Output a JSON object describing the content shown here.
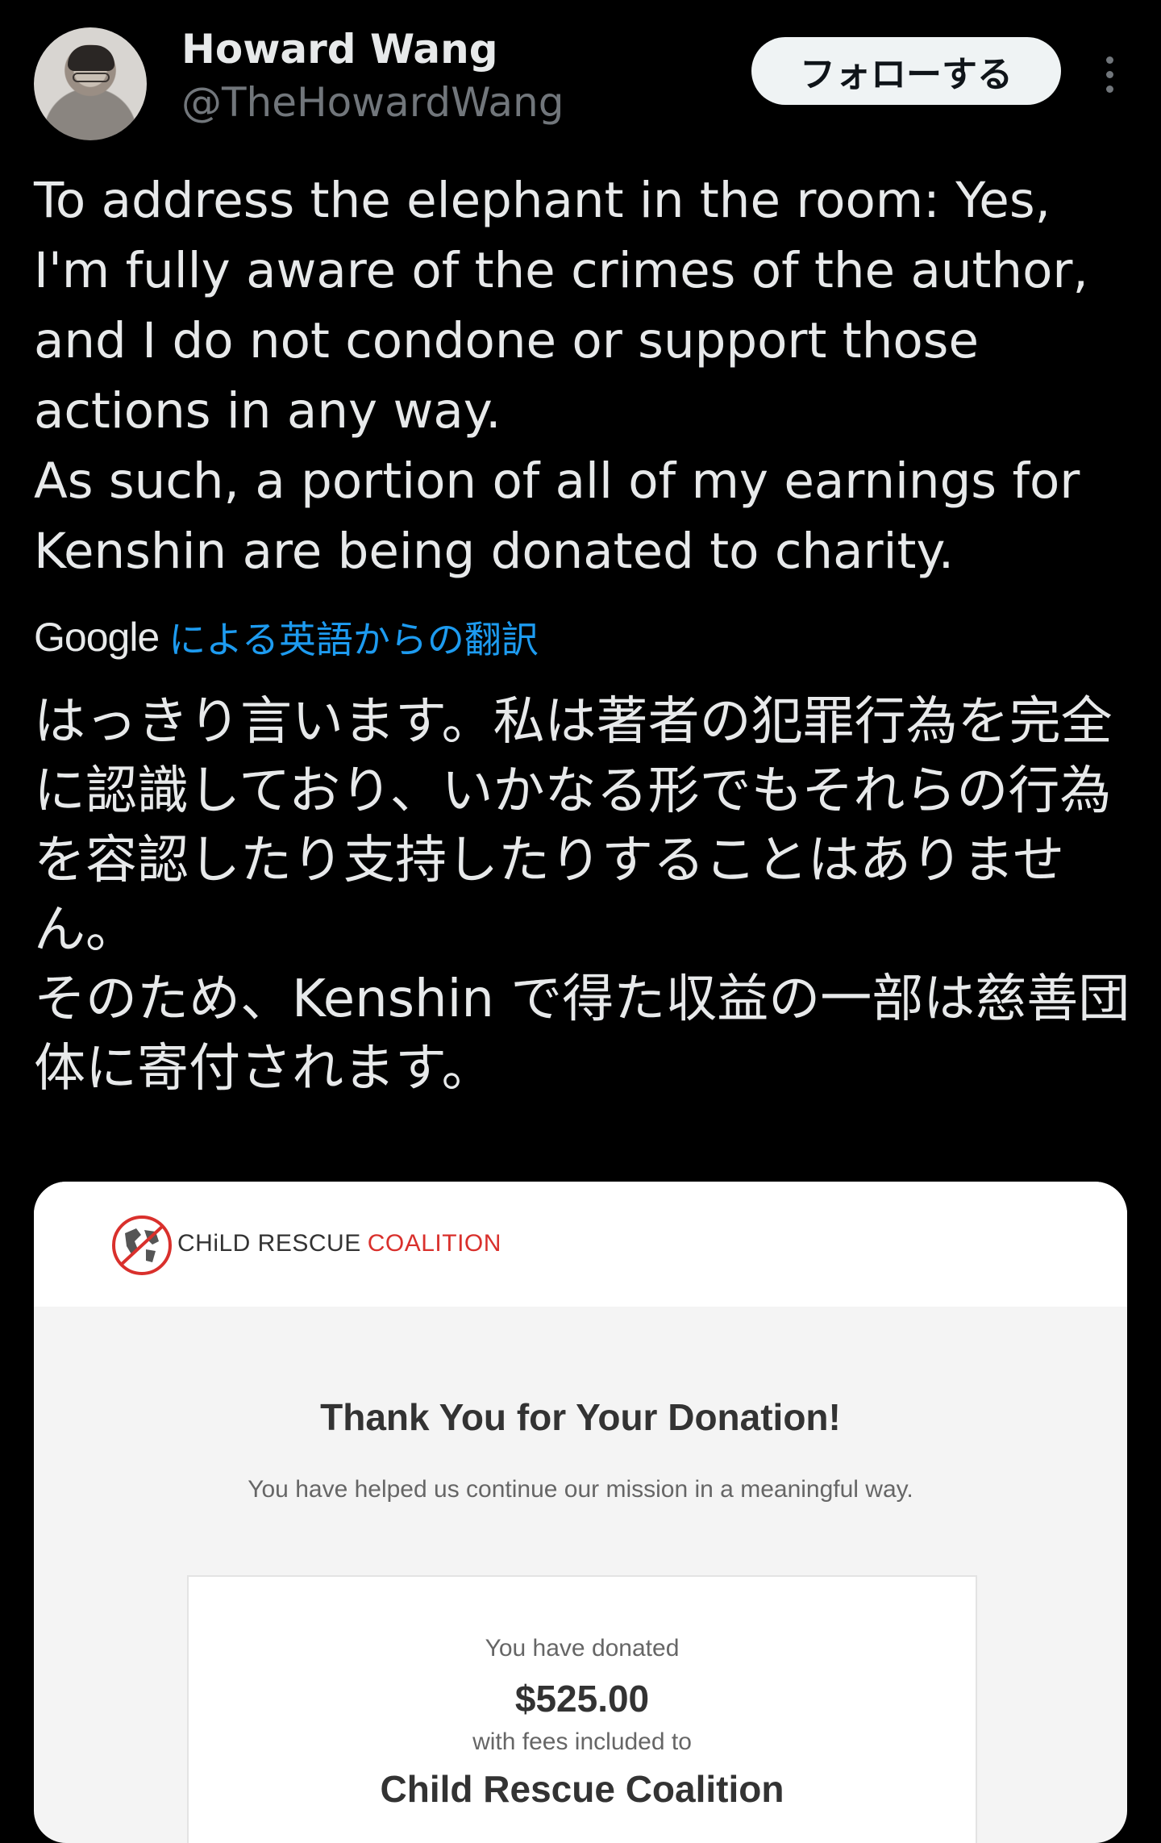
{
  "tweet": {
    "author": {
      "display_name": "Howard Wang",
      "handle": "@TheHowardWang"
    },
    "follow_label": "フォローする",
    "more_icon": "more-vertical-icon",
    "text": "To address the elephant in the room: Yes, I'm fully aware of the crimes of the author, and I do not condone or support those actions in any way.\nAs such, a portion of all of my earnings for Kenshin are being donated to charity.",
    "translation": {
      "provider": "Google",
      "link_label": "による英語からの翻訳",
      "text": "はっきり言います。私は著者の犯罪行為を完全に認識しており、いかなる形でもそれらの行為を容認したり支持したりすることはありません。\nそのため、Kenshin で得た収益の一部は慈善団体に寄付されます。"
    }
  },
  "media": {
    "org_logo_icon": "globe-circle-logo-icon",
    "org_name_part1": "CHiLD RESCUE",
    "org_name_part2": "COALITION",
    "title": "Thank You for Your Donation!",
    "subtitle": "You have helped us continue our mission in a meaningful way.",
    "receipt": {
      "donated_label": "You have donated",
      "amount": "$525.00",
      "fees_label": "with fees included to",
      "recipient": "Child Rescue Coalition"
    }
  },
  "colors": {
    "background": "#000000",
    "text_primary": "#e7e9ea",
    "text_secondary": "#71767b",
    "link": "#1d9bf0",
    "follow_button_bg": "#eff3f4",
    "brand_red": "#d9302c"
  }
}
